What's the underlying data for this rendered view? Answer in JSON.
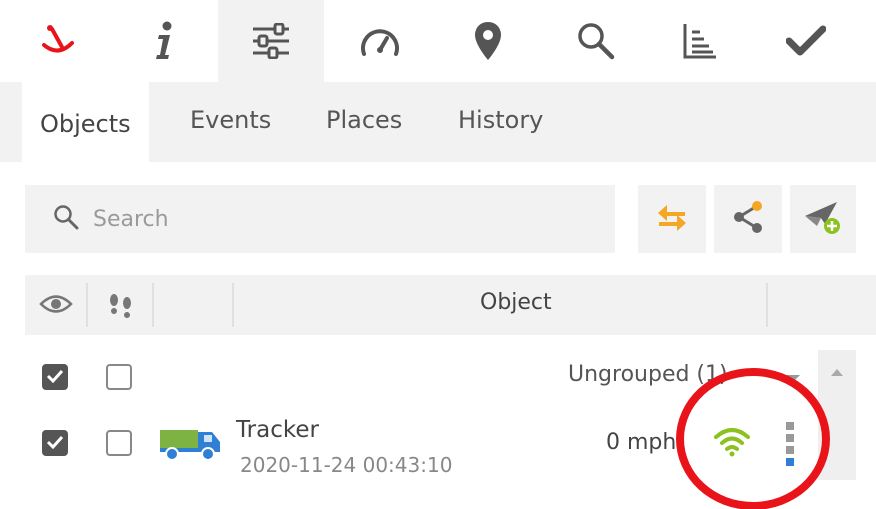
{
  "toolbar": {
    "items": [
      {
        "icon": "logo-icon",
        "active": false
      },
      {
        "icon": "info-icon",
        "active": false
      },
      {
        "icon": "sliders-icon",
        "active": true
      },
      {
        "icon": "speedometer-icon",
        "active": false
      },
      {
        "icon": "map-pin-icon",
        "active": false
      },
      {
        "icon": "search-icon",
        "active": false
      },
      {
        "icon": "chart-icon",
        "active": false
      },
      {
        "icon": "checkmark-icon",
        "active": false
      }
    ]
  },
  "subtabs": {
    "objects": "Objects",
    "events": "Events",
    "places": "Places",
    "history": "History"
  },
  "search": {
    "placeholder": "Search"
  },
  "table": {
    "header_object": "Object"
  },
  "group": {
    "label": "Ungrouped (1)",
    "visible_checked": true,
    "follow_checked": false
  },
  "objects": [
    {
      "name": "Tracker",
      "timestamp": "2020-11-24 00:43:10",
      "speed": "0 mph",
      "visible_checked": true,
      "follow_checked": false,
      "signal_status": "online"
    }
  ],
  "colors": {
    "accent_orange": "#f5a623",
    "signal_green": "#8cc21e",
    "truck_blue": "#2f7fd4",
    "truck_green": "#7cb342",
    "annotation_red": "#e8141a",
    "panel_gray": "#f2f2f2"
  }
}
